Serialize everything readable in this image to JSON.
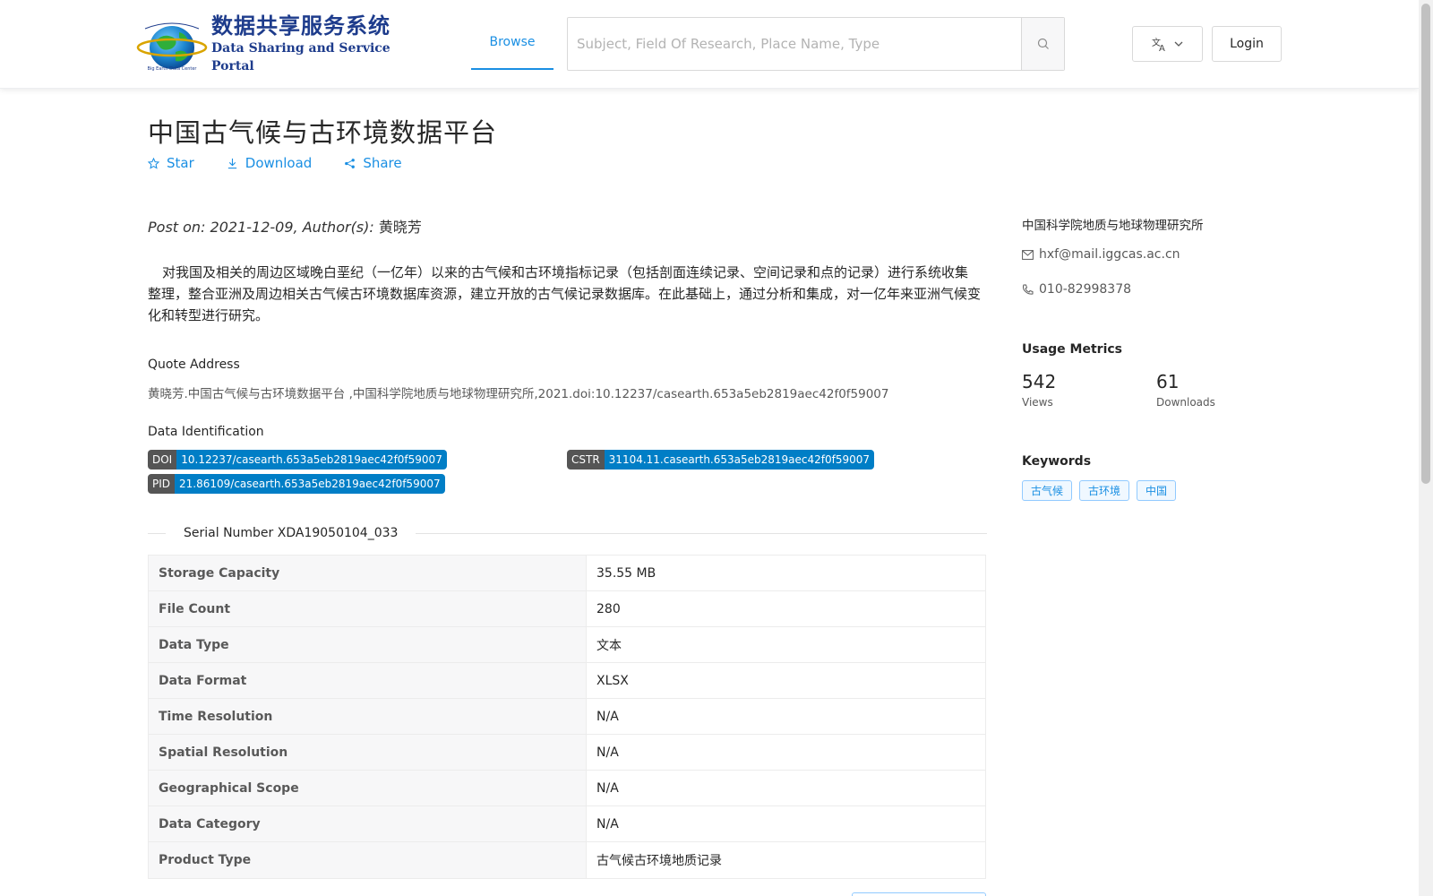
{
  "header": {
    "logo_cn": "数据共享服务系统",
    "logo_en": "Data Sharing and Service Portal",
    "nav_browse": "Browse",
    "search_placeholder": "Subject, Field Of Research, Place Name, Type",
    "login": "Login"
  },
  "dataset": {
    "title": "中国古气候与古环境数据平台",
    "actions": {
      "star": "Star",
      "download": "Download",
      "share": "Share"
    },
    "post_prefix": "Post on: 2021-12-09, Author(s): ",
    "author": "黄晓芳",
    "description": "对我国及相关的周边区域晚白垩纪（一亿年）以来的古气候和古环境指标记录（包括剖面连续记录、空间记录和点的记录）进行系统收集整理，整合亚洲及周边相关古气候古环境数据库资源，建立开放的古气候记录数据库。在此基础上，通过分析和集成，对一亿年来亚洲气候变化和转型进行研究。",
    "quote_label": "Quote Address",
    "quote_text": "黄晓芳.中国古气候与古环境数据平台 ,中国科学院地质与地球物理研究所,2021.doi:10.12237/casearth.653a5eb2819aec42f0f59007",
    "identification_label": "Data Identification",
    "doi": {
      "key": "DOI",
      "value": "10.12237/casearth.653a5eb2819aec42f0f59007"
    },
    "cstr": {
      "key": "CSTR",
      "value": "31104.11.casearth.653a5eb2819aec42f0f59007"
    },
    "pid": {
      "key": "PID",
      "value": "21.86109/casearth.653a5eb2819aec42f0f59007"
    },
    "serial": "Serial Number XDA19050104_033",
    "table": [
      {
        "label": "Storage Capacity",
        "value": "35.55 MB"
      },
      {
        "label": "File Count",
        "value": "280"
      },
      {
        "label": "Data Type",
        "value": "文本"
      },
      {
        "label": "Data Format",
        "value": "XLSX"
      },
      {
        "label": "Time Resolution",
        "value": "N/A"
      },
      {
        "label": "Spatial Resolution",
        "value": "N/A"
      },
      {
        "label": "Geographical Scope",
        "value": "N/A"
      },
      {
        "label": "Data Category",
        "value": "N/A"
      },
      {
        "label": "Product Type",
        "value": "古气候古环境地质记录"
      }
    ]
  },
  "sidebar": {
    "org": "中国科学院地质与地球物理研究所",
    "email": "hxf@mail.iggcas.ac.cn",
    "phone": "010-82998378",
    "metrics_title": "Usage Metrics",
    "views": "542",
    "views_label": "Views",
    "downloads": "61",
    "downloads_label": "Downloads",
    "keywords_title": "Keywords",
    "keywords": [
      "古气候",
      "古环境",
      "中国"
    ]
  },
  "colors": {
    "accent": "#1a8fe3",
    "badge_key": "#555555",
    "badge_value": "#007ec6",
    "logo_blue": "#1e3c8c"
  }
}
